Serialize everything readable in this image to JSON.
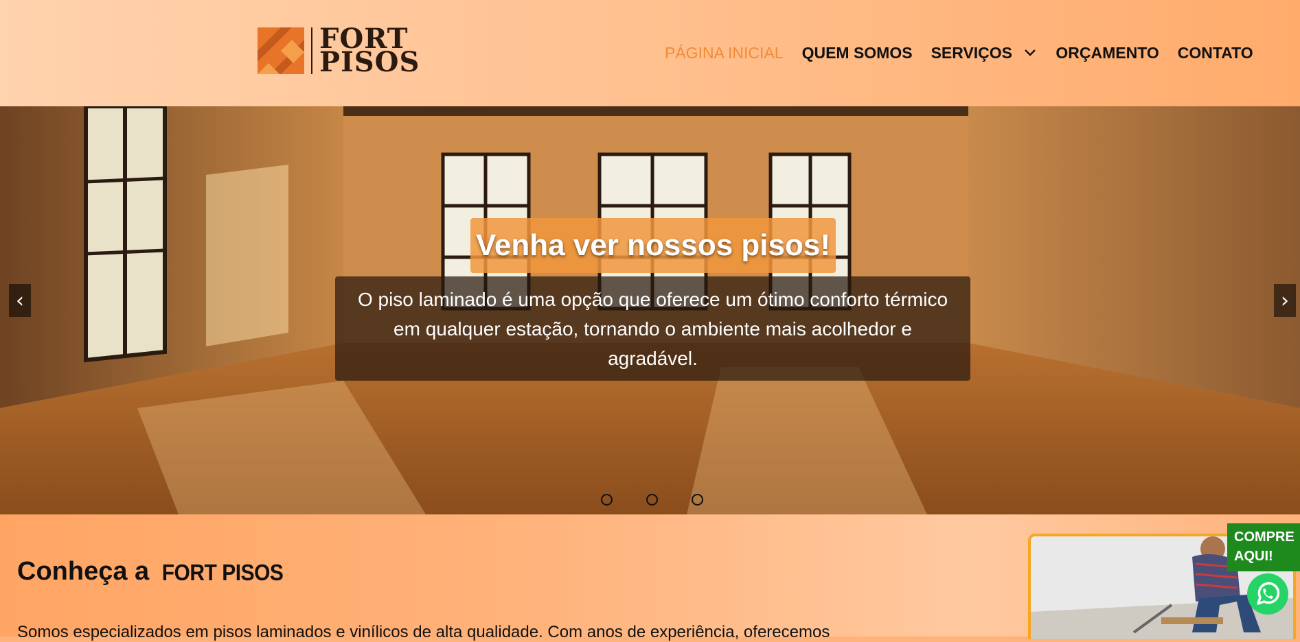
{
  "brand": {
    "line1": "FORT",
    "line2": "PISOS"
  },
  "nav": {
    "items": [
      {
        "label": "PÁGINA INICIAL",
        "active": true
      },
      {
        "label": "QUEM SOMOS",
        "active": false
      },
      {
        "label": "SERVIÇOS",
        "active": false,
        "has_dropdown": true
      },
      {
        "label": "ORÇAMENTO",
        "active": false
      },
      {
        "label": "CONTATO",
        "active": false
      }
    ]
  },
  "hero": {
    "title": "Venha ver nossos pisos!",
    "description": "O piso laminado é uma opção que oferece um ótimo conforto térmico em qualquer estação, tornando o ambiente mais acolhedor e agradável.",
    "prev_label": "‹",
    "next_label": "›",
    "slide_count": 3
  },
  "about": {
    "title_prefix": "Conheça a",
    "title_brand": "FORT PISOS",
    "text": "Somos especializados em pisos laminados e vinílicos de alta qualidade. Com anos de experiência, oferecemos"
  },
  "promo": {
    "badge": "COMPRE AQUI!"
  },
  "colors": {
    "accent": "#f08c37",
    "header_bg": "#ffc08f",
    "badge_green": "#1e8a1e",
    "whatsapp": "#25d366"
  },
  "icons": [
    "logo-mark-icon",
    "chevron-down-icon",
    "whatsapp-icon"
  ]
}
